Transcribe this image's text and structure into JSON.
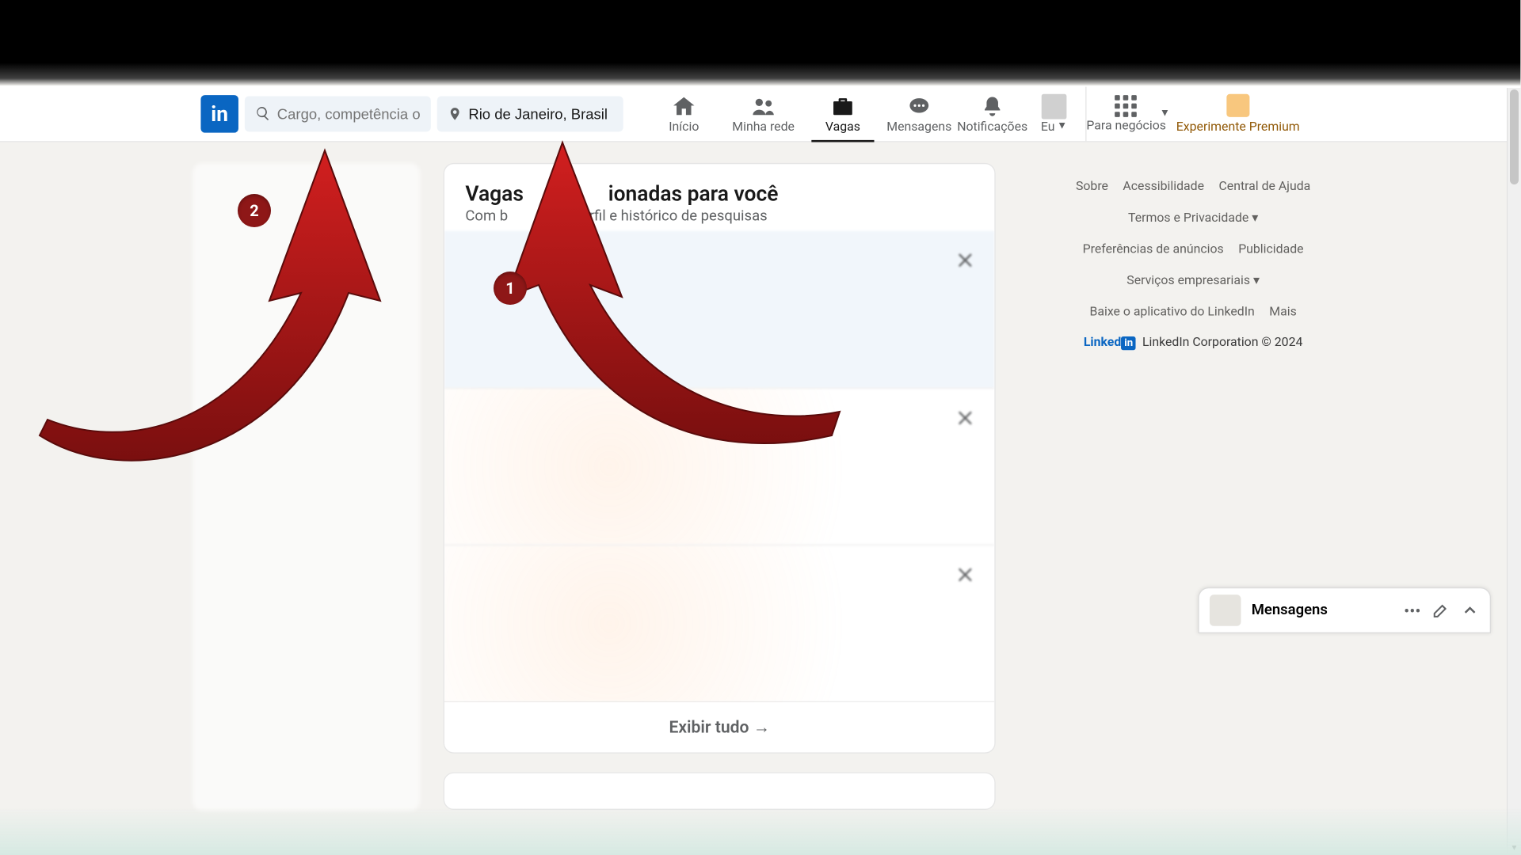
{
  "header": {
    "search_placeholder": "Cargo, competência o...",
    "location_value": "Rio de Janeiro, Brasil",
    "nav": {
      "home": "Início",
      "network": "Minha rede",
      "jobs": "Vagas",
      "messaging": "Mensagens",
      "notifications": "Notificações",
      "me": "Eu",
      "business": "Para negócios",
      "premium": "Experimente Premium"
    }
  },
  "main": {
    "title": "Vagas selecionadas para você",
    "title_visible_prefix": "Vagas",
    "title_visible_suffix": "ionadas para você",
    "subtitle": "Com base no seu perfil e histórico de pesquisas",
    "subtitle_visible_prefix": "Com b",
    "subtitle_visible_suffix": "perfil e histórico de pesquisas",
    "show_all": "Exibir tudo →"
  },
  "footer": {
    "links": {
      "about": "Sobre",
      "accessibility": "Acessibilidade",
      "help": "Central de Ajuda",
      "privacy": "Termos e Privacidade",
      "ad_prefs": "Preferências de anúncios",
      "advertising": "Publicidade",
      "biz_services": "Serviços empresariais",
      "get_app": "Baixe o aplicativo do LinkedIn",
      "more": "Mais"
    },
    "brand_prefix": "Linked",
    "brand_suffix": "in",
    "copyright": "LinkedIn Corporation © 2024"
  },
  "messaging_dock": {
    "title": "Mensagens"
  },
  "annotations": {
    "badge1": "1",
    "badge2": "2"
  }
}
